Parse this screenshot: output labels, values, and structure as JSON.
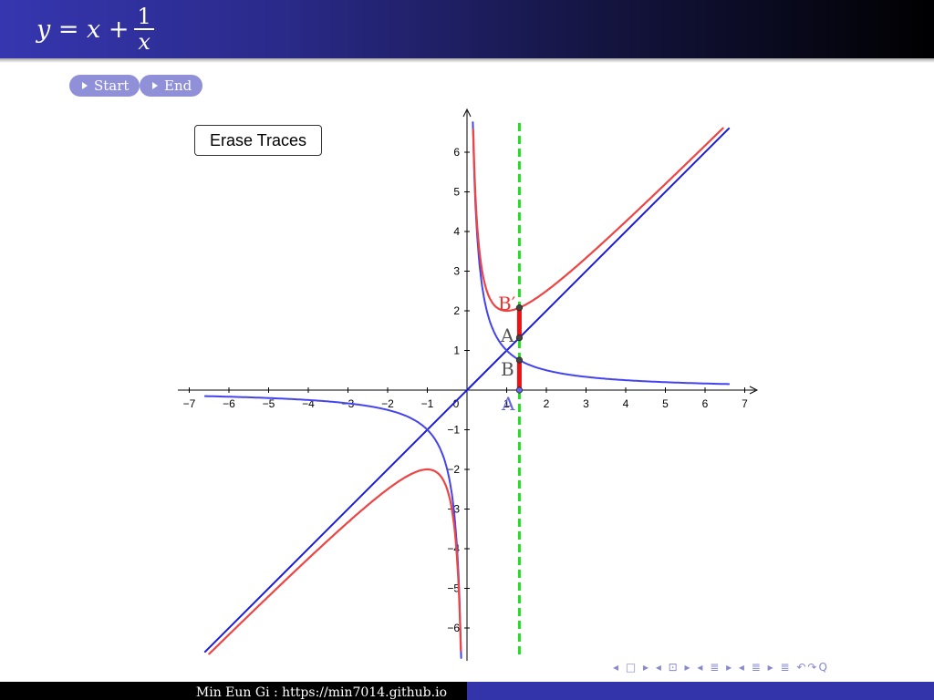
{
  "header": {
    "title_lhs": "y = x +",
    "title_frac_num": "1",
    "title_frac_den": "x",
    "colors": {
      "gradient_start": "#3636b0",
      "gradient_end": "#000000"
    }
  },
  "nav_buttons": [
    {
      "label": "Start"
    },
    {
      "label": "End"
    }
  ],
  "erase_button": {
    "label": "Erase Traces"
  },
  "graph": {
    "x_ticks": [
      "−7",
      "−6",
      "−5",
      "−4",
      "−3",
      "−2",
      "−1",
      "0",
      "1",
      "2",
      "3",
      "4",
      "5",
      "6",
      "7"
    ],
    "y_ticks": [
      "6",
      "5",
      "4",
      "3",
      "2",
      "1",
      "−1",
      "−2",
      "−3",
      "−4",
      "−5",
      "−6"
    ],
    "labels": {
      "A_prime": "A",
      "A": "A",
      "B": "B",
      "B_prime": "B′"
    },
    "slider_x": 1.32,
    "colors": {
      "line": "#1a1adc",
      "hyperbola": "#4444ee",
      "sum": "#ee4444",
      "slider": "#22dd22",
      "segment": "#ee1111"
    }
  },
  "beamer_nav": {
    "symbols": "◂ □ ▸ ◂ ⊡ ▸ ◂ ≣ ▸ ◂ ≣ ▸   ≣   ↶↷Q"
  },
  "footer": {
    "text": "Min Eun Gi : https://min7014.github.io"
  }
}
